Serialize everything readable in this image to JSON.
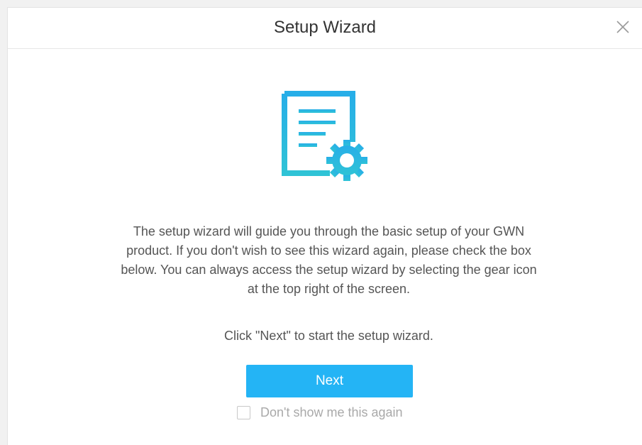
{
  "dialog": {
    "title": "Setup Wizard",
    "close_icon": "close-icon",
    "illustration_icon": "document-gear-icon",
    "description": "The setup wizard will guide you through the basic setup of your GWN product. If you don't wish to see this wizard again, please check the box below. You can always access the setup wizard by selecting the gear icon at the top right of the screen.",
    "hint": "Click \"Next\" to start the setup wizard.",
    "next_label": "Next",
    "dont_show_label": "Don't show me this again",
    "dont_show_checked": false
  },
  "colors": {
    "accent": "#24b4f5",
    "icon_gradient_top": "#27aee8",
    "icon_gradient_bottom": "#2fc3d6"
  }
}
